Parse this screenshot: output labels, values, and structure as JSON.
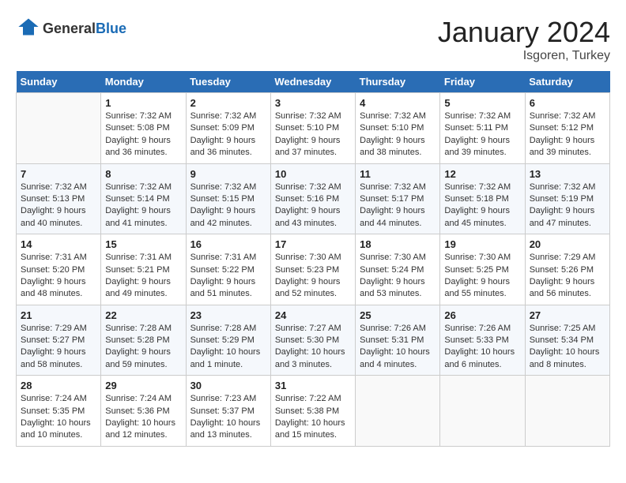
{
  "header": {
    "logo_line1": "General",
    "logo_line2": "Blue",
    "title": "January 2024",
    "subtitle": "Isgoren, Turkey"
  },
  "calendar": {
    "days_of_week": [
      "Sunday",
      "Monday",
      "Tuesday",
      "Wednesday",
      "Thursday",
      "Friday",
      "Saturday"
    ],
    "weeks": [
      [
        {
          "day": "",
          "info": ""
        },
        {
          "day": "1",
          "info": "Sunrise: 7:32 AM\nSunset: 5:08 PM\nDaylight: 9 hours\nand 36 minutes."
        },
        {
          "day": "2",
          "info": "Sunrise: 7:32 AM\nSunset: 5:09 PM\nDaylight: 9 hours\nand 36 minutes."
        },
        {
          "day": "3",
          "info": "Sunrise: 7:32 AM\nSunset: 5:10 PM\nDaylight: 9 hours\nand 37 minutes."
        },
        {
          "day": "4",
          "info": "Sunrise: 7:32 AM\nSunset: 5:10 PM\nDaylight: 9 hours\nand 38 minutes."
        },
        {
          "day": "5",
          "info": "Sunrise: 7:32 AM\nSunset: 5:11 PM\nDaylight: 9 hours\nand 39 minutes."
        },
        {
          "day": "6",
          "info": "Sunrise: 7:32 AM\nSunset: 5:12 PM\nDaylight: 9 hours\nand 39 minutes."
        }
      ],
      [
        {
          "day": "7",
          "info": "Sunrise: 7:32 AM\nSunset: 5:13 PM\nDaylight: 9 hours\nand 40 minutes."
        },
        {
          "day": "8",
          "info": "Sunrise: 7:32 AM\nSunset: 5:14 PM\nDaylight: 9 hours\nand 41 minutes."
        },
        {
          "day": "9",
          "info": "Sunrise: 7:32 AM\nSunset: 5:15 PM\nDaylight: 9 hours\nand 42 minutes."
        },
        {
          "day": "10",
          "info": "Sunrise: 7:32 AM\nSunset: 5:16 PM\nDaylight: 9 hours\nand 43 minutes."
        },
        {
          "day": "11",
          "info": "Sunrise: 7:32 AM\nSunset: 5:17 PM\nDaylight: 9 hours\nand 44 minutes."
        },
        {
          "day": "12",
          "info": "Sunrise: 7:32 AM\nSunset: 5:18 PM\nDaylight: 9 hours\nand 45 minutes."
        },
        {
          "day": "13",
          "info": "Sunrise: 7:32 AM\nSunset: 5:19 PM\nDaylight: 9 hours\nand 47 minutes."
        }
      ],
      [
        {
          "day": "14",
          "info": "Sunrise: 7:31 AM\nSunset: 5:20 PM\nDaylight: 9 hours\nand 48 minutes."
        },
        {
          "day": "15",
          "info": "Sunrise: 7:31 AM\nSunset: 5:21 PM\nDaylight: 9 hours\nand 49 minutes."
        },
        {
          "day": "16",
          "info": "Sunrise: 7:31 AM\nSunset: 5:22 PM\nDaylight: 9 hours\nand 51 minutes."
        },
        {
          "day": "17",
          "info": "Sunrise: 7:30 AM\nSunset: 5:23 PM\nDaylight: 9 hours\nand 52 minutes."
        },
        {
          "day": "18",
          "info": "Sunrise: 7:30 AM\nSunset: 5:24 PM\nDaylight: 9 hours\nand 53 minutes."
        },
        {
          "day": "19",
          "info": "Sunrise: 7:30 AM\nSunset: 5:25 PM\nDaylight: 9 hours\nand 55 minutes."
        },
        {
          "day": "20",
          "info": "Sunrise: 7:29 AM\nSunset: 5:26 PM\nDaylight: 9 hours\nand 56 minutes."
        }
      ],
      [
        {
          "day": "21",
          "info": "Sunrise: 7:29 AM\nSunset: 5:27 PM\nDaylight: 9 hours\nand 58 minutes."
        },
        {
          "day": "22",
          "info": "Sunrise: 7:28 AM\nSunset: 5:28 PM\nDaylight: 9 hours\nand 59 minutes."
        },
        {
          "day": "23",
          "info": "Sunrise: 7:28 AM\nSunset: 5:29 PM\nDaylight: 10 hours\nand 1 minute."
        },
        {
          "day": "24",
          "info": "Sunrise: 7:27 AM\nSunset: 5:30 PM\nDaylight: 10 hours\nand 3 minutes."
        },
        {
          "day": "25",
          "info": "Sunrise: 7:26 AM\nSunset: 5:31 PM\nDaylight: 10 hours\nand 4 minutes."
        },
        {
          "day": "26",
          "info": "Sunrise: 7:26 AM\nSunset: 5:33 PM\nDaylight: 10 hours\nand 6 minutes."
        },
        {
          "day": "27",
          "info": "Sunrise: 7:25 AM\nSunset: 5:34 PM\nDaylight: 10 hours\nand 8 minutes."
        }
      ],
      [
        {
          "day": "28",
          "info": "Sunrise: 7:24 AM\nSunset: 5:35 PM\nDaylight: 10 hours\nand 10 minutes."
        },
        {
          "day": "29",
          "info": "Sunrise: 7:24 AM\nSunset: 5:36 PM\nDaylight: 10 hours\nand 12 minutes."
        },
        {
          "day": "30",
          "info": "Sunrise: 7:23 AM\nSunset: 5:37 PM\nDaylight: 10 hours\nand 13 minutes."
        },
        {
          "day": "31",
          "info": "Sunrise: 7:22 AM\nSunset: 5:38 PM\nDaylight: 10 hours\nand 15 minutes."
        },
        {
          "day": "",
          "info": ""
        },
        {
          "day": "",
          "info": ""
        },
        {
          "day": "",
          "info": ""
        }
      ]
    ]
  }
}
